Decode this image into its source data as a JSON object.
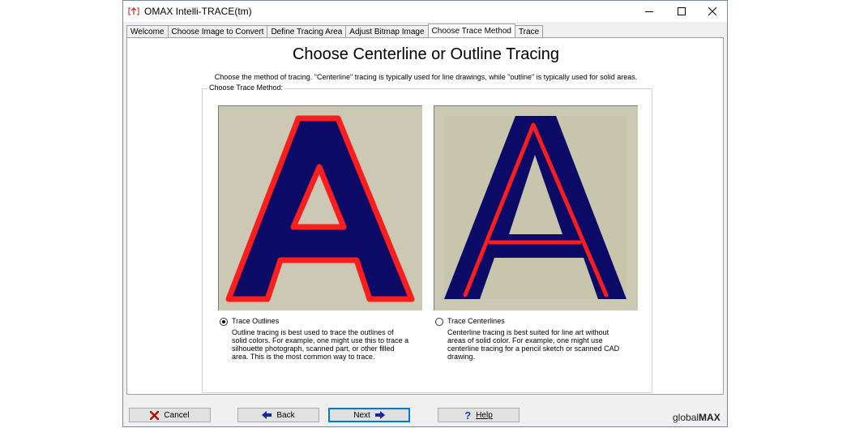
{
  "window": {
    "title": "OMAX Intelli-TRACE(tm)",
    "icon": "omax-app-icon",
    "controls": [
      "minimize-icon",
      "maximize-icon",
      "close-icon"
    ]
  },
  "tabs": [
    {
      "label": "Welcome",
      "active": false
    },
    {
      "label": "Choose Image to Convert",
      "active": false
    },
    {
      "label": "Define Tracing Area",
      "active": false
    },
    {
      "label": "Adjust Bitmap Image",
      "active": false
    },
    {
      "label": "Choose Trace Method",
      "active": true
    },
    {
      "label": "Trace",
      "active": false
    }
  ],
  "page": {
    "heading": "Choose Centerline or Outline Tracing",
    "description": "Choose the method of tracing.  \"Centerline\" tracing is typically used for line drawings, while \"outline\" is typically used for solid areas.",
    "group_label": "Choose Trace Method:"
  },
  "options": {
    "outline": {
      "label": "Trace Outlines",
      "selected": true,
      "description": "Outline tracing is best used to trace the outlines of solid colors.  For example, one might use this to trace a silhouette photograph, scanned part, or other filled area.  This is the most common way to trace."
    },
    "centerline": {
      "label": "Trace Centerlines",
      "selected": false,
      "description": "Centerline tracing is best suited for line art without areas of solid color.  For example, one might use centerline tracing for a pencil sketch or scanned CAD drawing."
    }
  },
  "buttons": {
    "cancel": "Cancel",
    "back": "Back",
    "next": "Next",
    "help": "Help"
  },
  "brand": {
    "light": "global",
    "bold": "MAX"
  },
  "colors": {
    "letter_fill": "#0b0a66",
    "trace_line": "#ff1e1e",
    "image_bg": "#cbc9b3",
    "accent": "#0078d7"
  }
}
